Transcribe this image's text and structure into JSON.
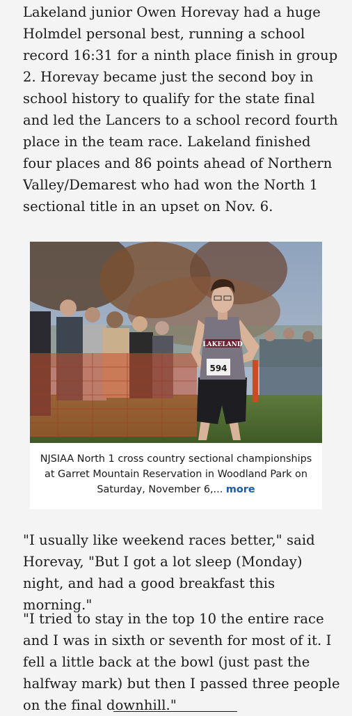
{
  "article": {
    "paragraph_1": "Lakeland junior Owen Horevay had a huge Holmdel personal best, running a school record 16:31 for a ninth place finish in group 2. Horevay became just the second boy in school history to qualify for the state final and led the Lancers to a school record fourth place in the team race. Lakeland finished four places and 86 points ahead of Northern Valley/Demarest who had won the North 1 sectional title in an upset on Nov. 6.",
    "photo": {
      "caption": "NJSIAA North 1 cross country sectional championships at Garret Mountain Reservation in Woodland Park on Saturday, November 6,...",
      "more_label": "more",
      "jersey_text": "LAKELAND",
      "bib_number": "594"
    },
    "paragraph_2": "\"I usually like weekend races better,\" said Horevay, \"But I got a lot sleep (Monday) night, and had a good breakfast this morning.\"",
    "paragraph_3": "\"I tried to stay in the top 10 the entire race and I was in sixth or seventh for most of it. I fell a little back at the bowl (just past the halfway mark) but then I passed three people on the final downhill.\""
  }
}
